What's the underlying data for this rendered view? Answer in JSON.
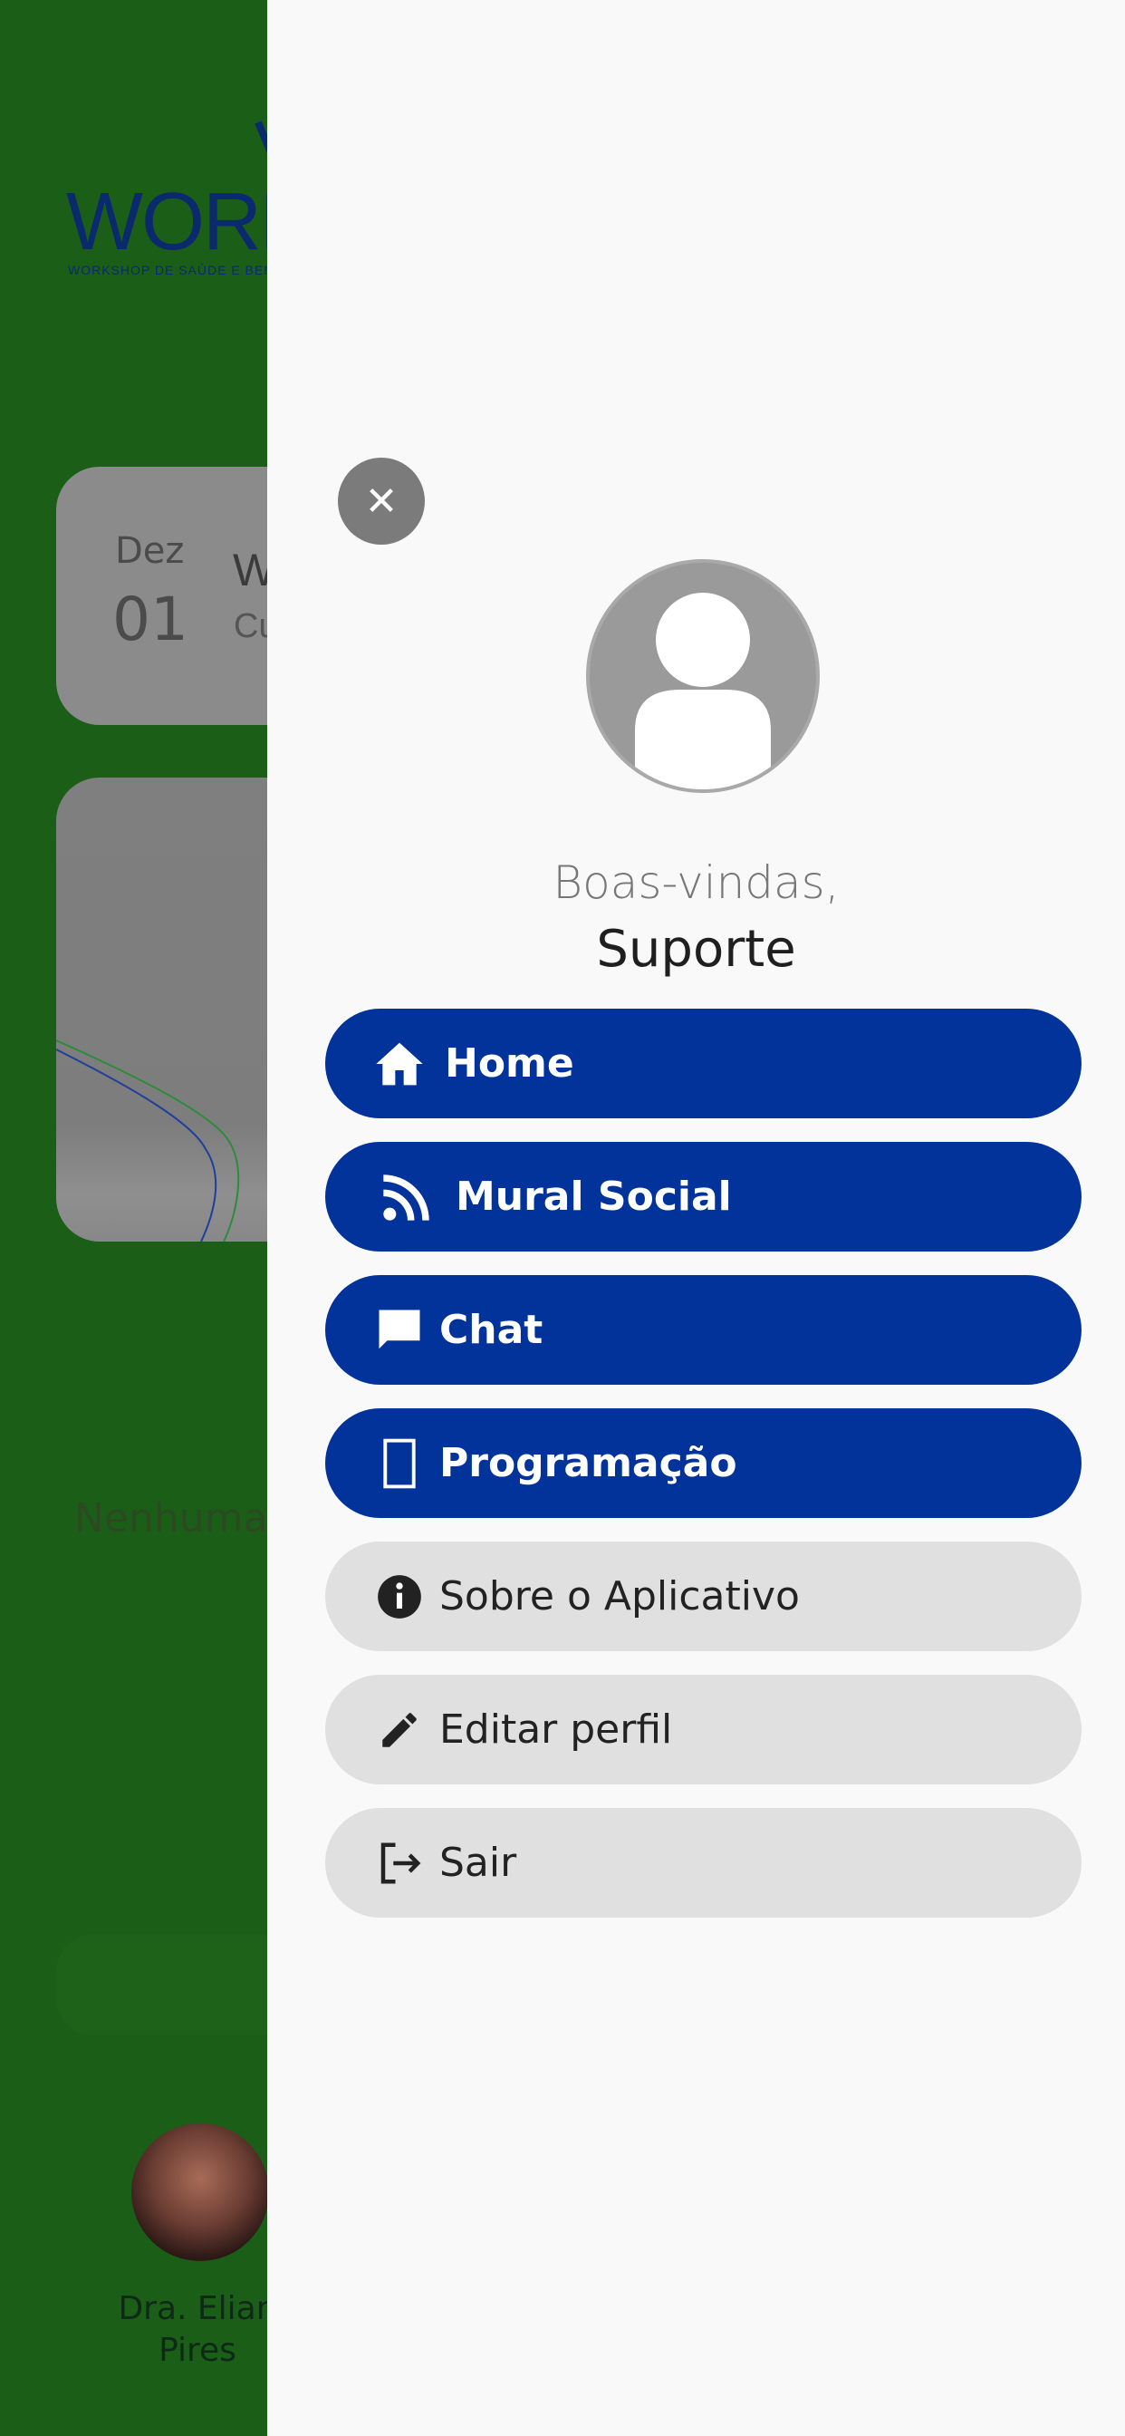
{
  "background": {
    "logo": {
      "wordmark": "WORK",
      "tagline": "WORKSHOP DE SAÚDE E BEM-"
    },
    "event_card": {
      "month": "Dez",
      "day": "01",
      "title_fragment": "W",
      "subtitle_fragment": "Cu"
    },
    "empty_text": "Nenhuma",
    "speaker": {
      "name_line1": "Dra. Elian",
      "name_line2": "Pires"
    }
  },
  "drawer": {
    "close_icon": "close-icon",
    "avatar_icon": "user-avatar-icon",
    "welcome": "Boas-vindas,",
    "username": "Suporte",
    "menu": [
      {
        "label": "Home",
        "icon": "home-icon",
        "style": "primary"
      },
      {
        "label": "Mural Social",
        "icon": "rss-feed-icon",
        "style": "primary"
      },
      {
        "label": "Chat",
        "icon": "chat-icon",
        "style": "primary"
      },
      {
        "label": "Programação",
        "icon": "schedule-icon",
        "style": "primary"
      },
      {
        "label": "Sobre o Aplicativo",
        "icon": "info-icon",
        "style": "secondary"
      },
      {
        "label": "Editar perfil",
        "icon": "edit-pencil-icon",
        "style": "secondary"
      },
      {
        "label": "Sair",
        "icon": "logout-icon",
        "style": "secondary"
      }
    ]
  },
  "colors": {
    "background_green": "#1b5e18",
    "drawer_bg": "#f9f9f9",
    "primary_button": "#01339a",
    "secondary_button": "#e0e0e0",
    "close_button": "#7b7b7b"
  }
}
